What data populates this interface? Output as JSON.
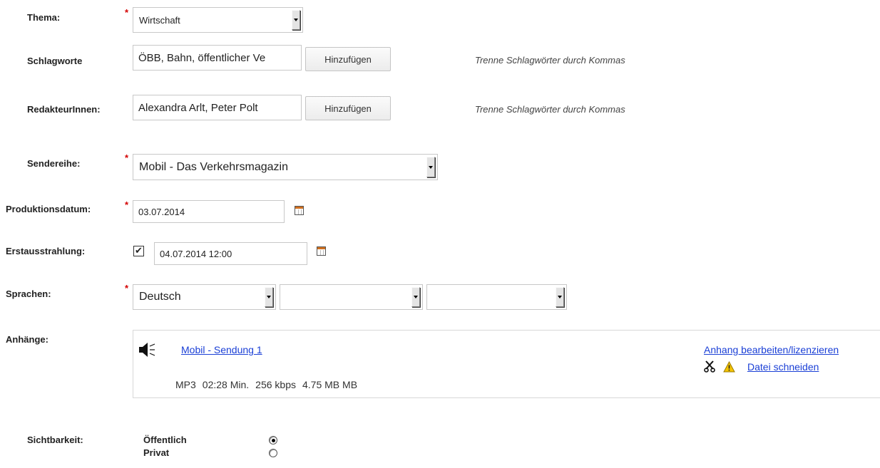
{
  "thema": {
    "label": "Thema:",
    "required_mark": "*",
    "value": "Wirtschaft"
  },
  "schlagworte": {
    "label": "Schlagworte",
    "value": "ÖBB, Bahn, öffentlicher Ve",
    "add_button": "Hinzufügen",
    "hint": "Trenne Schlagwörter durch Kommas"
  },
  "redakteure": {
    "label": "RedakteurInnen:",
    "value": "Alexandra Arlt, Peter Polt",
    "add_button": "Hinzufügen",
    "hint": "Trenne Schlagwörter durch Kommas"
  },
  "sendereihe": {
    "label": "Sendereihe:",
    "required_mark": "*",
    "value": "Mobil - Das Verkehrsmagazin"
  },
  "produktionsdatum": {
    "label": "Produktionsdatum:",
    "required_mark": "*",
    "value": "03.07.2014",
    "icon": "calendar-icon"
  },
  "erstausstrahlung": {
    "label": "Erstausstrahlung:",
    "checked_glyph": "✔",
    "value": "04.07.2014 12:00",
    "icon": "calendar-icon"
  },
  "sprachen": {
    "label": "Sprachen:",
    "required_mark": "*",
    "values": [
      "Deutsch",
      "",
      ""
    ]
  },
  "anhaenge": {
    "label": "Anhänge:",
    "file_icon": "speaker-icon",
    "title": "Mobil - Sendung 1",
    "edit_link": "Anhang bearbeiten/lizenzieren",
    "cut_icon": "scissors-icon",
    "warning_icon": "warning-icon",
    "cut_link": "Datei schneiden",
    "format": "MP3",
    "duration": "02:28 Min.",
    "bitrate": "256 kbps",
    "size": "4.75 MB MB"
  },
  "sichtbarkeit": {
    "label": "Sichtbarkeit:",
    "options": [
      {
        "label": "Öffentlich",
        "selected": true
      },
      {
        "label": "Privat",
        "selected": false
      }
    ]
  },
  "colors": {
    "required": "#d40000",
    "link": "#1a3fd6",
    "warning": "#f5c400"
  }
}
